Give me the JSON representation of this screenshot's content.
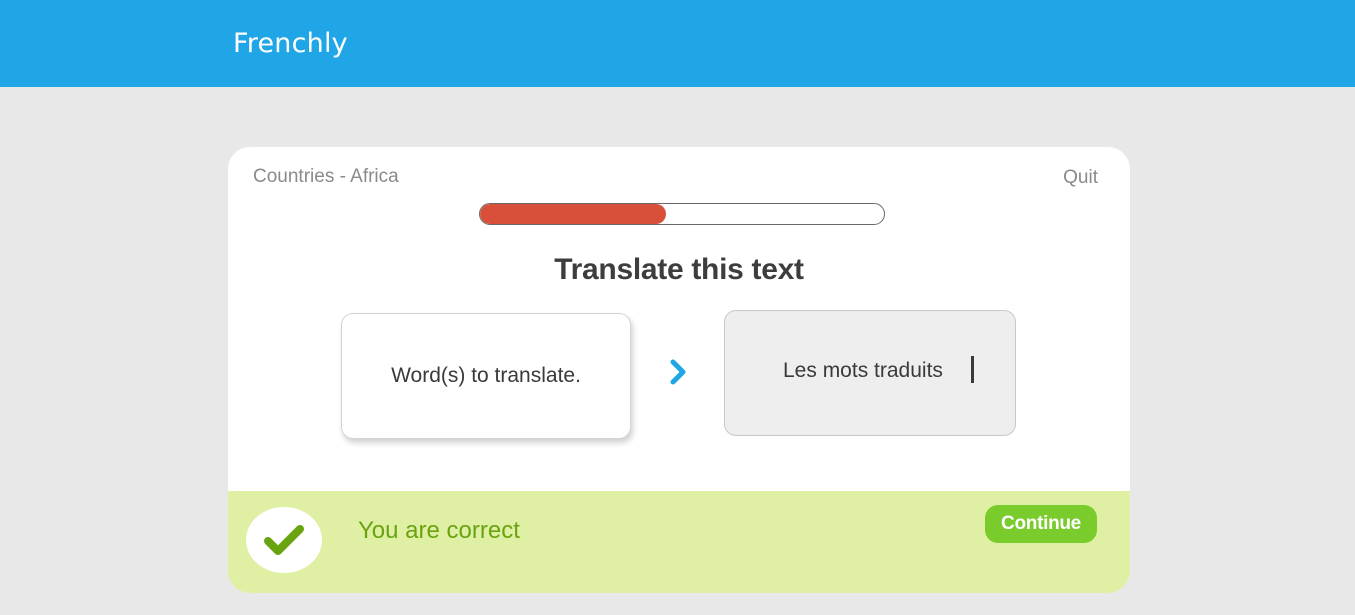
{
  "app": {
    "brand": "Frenchly",
    "brand_color": "#20a6e6"
  },
  "lesson": {
    "name": "Countries - Africa",
    "quit_label": "Quit",
    "progress": 0.46,
    "progress_color": "#d84f3a"
  },
  "exercise": {
    "prompt": "Translate this text",
    "source_text": "Word(s) to translate.",
    "arrow_icon": "chevron-right-icon",
    "answer_text": "Les mots traduits"
  },
  "feedback": {
    "icon": "checkmark-icon",
    "message": "You are correct",
    "continue_label": "Continue",
    "background_color": "#dff0a4",
    "accent_color": "#7acc2c"
  }
}
